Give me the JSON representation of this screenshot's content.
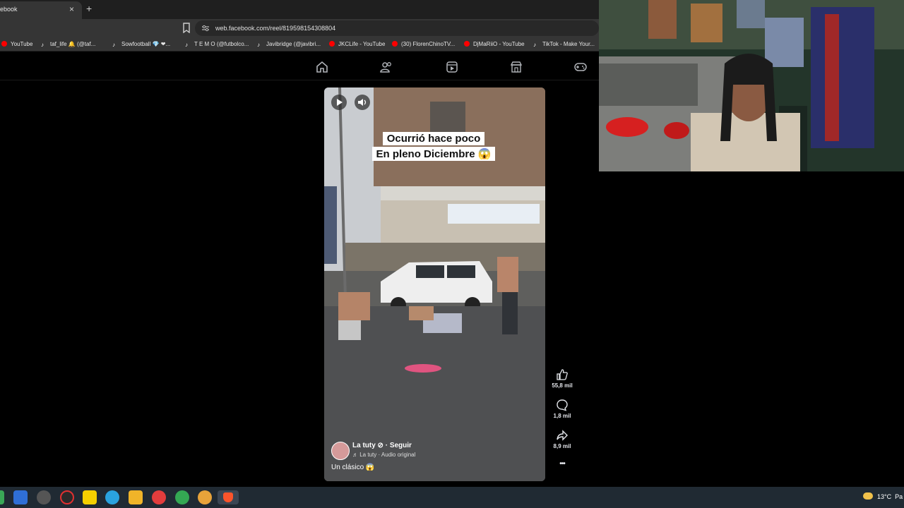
{
  "browser": {
    "tab": {
      "title": "ebook",
      "close_icon": "×"
    },
    "new_tab_icon": "+",
    "url": "web.facebook.com/reel/819598154308804",
    "bookmarks": [
      {
        "label": "YouTube",
        "icon": "youtube-icon"
      },
      {
        "label": "taf_life 🔔 (@taf...",
        "icon": "tiktok-icon"
      },
      {
        "label": "Sowfootball 💎 ❤...",
        "icon": "tiktok-icon"
      },
      {
        "label": "T E M O (@futbolco...",
        "icon": "tiktok-icon"
      },
      {
        "label": "Javibridge (@javibri...",
        "icon": "tiktok-icon"
      },
      {
        "label": "JKCLife - YouTube",
        "icon": "youtube-icon"
      },
      {
        "label": "(30) FlorenChinoTV...",
        "icon": "youtube-icon"
      },
      {
        "label": "DjMaRiiO - YouTube",
        "icon": "youtube-icon"
      },
      {
        "label": "TikTok - Make Your...",
        "icon": "tiktok-icon"
      }
    ]
  },
  "facebook_nav": [
    "home-icon",
    "friends-icon",
    "video-icon",
    "marketplace-icon",
    "gaming-icon"
  ],
  "reel": {
    "caption_line1": "Ocurrió hace poco",
    "caption_line2": "En pleno Diciembre 😱",
    "author": "La tuty ⊘ · Seguir",
    "audio": "♬ La tuty · Audio original",
    "description": "Un clásico 😱",
    "likes": "55,8 mil",
    "comments": "1,8 mil",
    "shares": "8,9 mil",
    "more_icon": "•••"
  },
  "taskbar": {
    "weather": "13°C",
    "trailing_text": "Pa"
  },
  "colors": {
    "chrome_dark": "#1f1f1f",
    "chrome_mid": "#353535",
    "youtube_red": "#ff0000",
    "taskbar": "#202a33"
  }
}
